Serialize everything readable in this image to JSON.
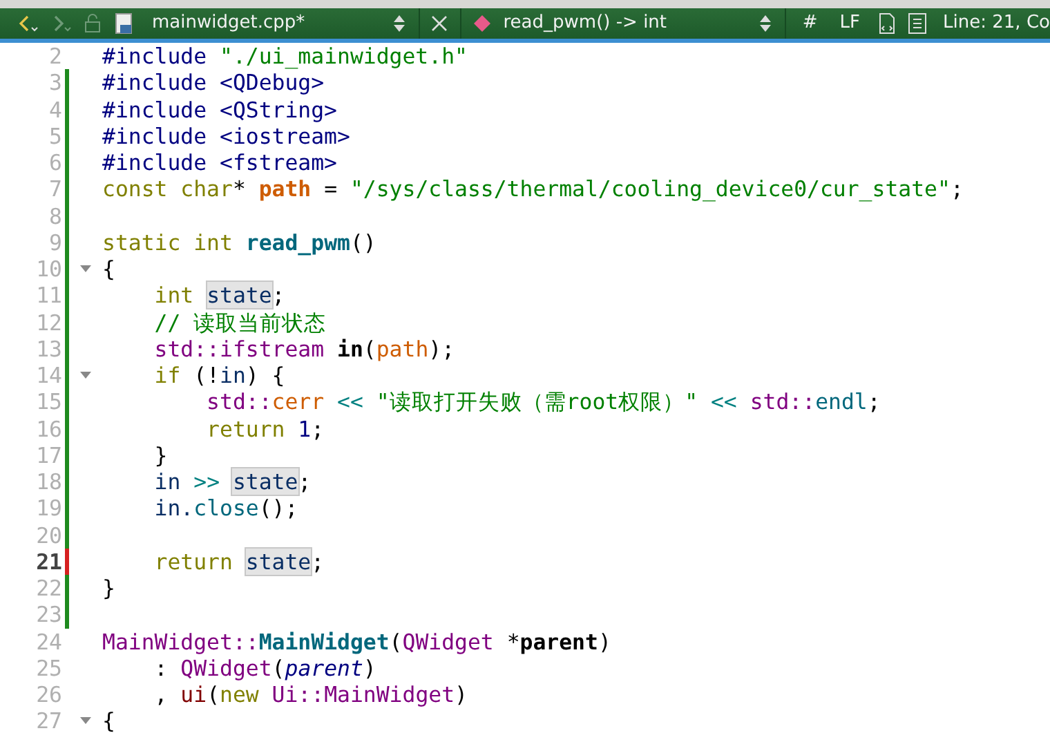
{
  "toolbar": {
    "back_enabled": true,
    "forward_enabled": false,
    "file_name": "mainwidget.cpp*",
    "symbol": "read_pwm() -> int",
    "hash": "#",
    "line_ending": "LF",
    "position": "Line: 21, Co"
  },
  "editor": {
    "lines": [
      {
        "number": "2",
        "fold": false,
        "current": false,
        "tokens": [
          {
            "kind": "preproc",
            "text": "#include "
          },
          {
            "kind": "string",
            "text": "\"./ui_mainwidget.h\""
          }
        ]
      },
      {
        "number": "3",
        "color": "#1e8a1e",
        "fold": false,
        "current": false,
        "tokens": [
          {
            "kind": "preproc",
            "text": "#include <QDebug>"
          }
        ]
      },
      {
        "number": "4",
        "color": "#1e8a1e",
        "fold": false,
        "current": false,
        "tokens": [
          {
            "kind": "preproc",
            "text": "#include <QString>"
          }
        ]
      },
      {
        "number": "5",
        "color": "#1e8a1e",
        "fold": false,
        "current": false,
        "tokens": [
          {
            "kind": "preproc",
            "text": "#include <iostream>"
          }
        ]
      },
      {
        "number": "6",
        "color": "#1e8a1e",
        "fold": false,
        "current": false,
        "tokens": [
          {
            "kind": "preproc",
            "text": "#include <fstream>"
          }
        ]
      },
      {
        "number": "7",
        "color": "#1e8a1e",
        "fold": false,
        "current": false,
        "tokens": [
          {
            "kind": "keyword",
            "text": "const char"
          },
          {
            "kind": "plain",
            "text": "* "
          },
          {
            "kind": "global",
            "text": "path"
          },
          {
            "kind": "plain",
            "text": " = "
          },
          {
            "kind": "string",
            "text": "\"/sys/class/thermal/cooling_device0/cur_state\""
          },
          {
            "kind": "plain",
            "text": ";"
          }
        ]
      },
      {
        "number": "8",
        "color": "#1e8a1e",
        "fold": false,
        "current": false
      },
      {
        "number": "9",
        "color": "#1e8a1e",
        "fold": false,
        "current": false,
        "tokens": [
          {
            "kind": "keyword",
            "text": "static int "
          },
          {
            "kind": "funcdef",
            "text": "read_pwm"
          },
          {
            "kind": "plain",
            "text": "()"
          }
        ]
      },
      {
        "number": "10",
        "color": "#1e8a1e",
        "fold": true,
        "current": false,
        "tokens": [
          {
            "kind": "plain",
            "text": "{"
          }
        ]
      },
      {
        "number": "11",
        "color": "#1e8a1e",
        "fold": false,
        "current": false,
        "tokens": [
          {
            "kind": "keyword",
            "text": "    int "
          },
          {
            "kind": "occurrence",
            "text": "state"
          },
          {
            "kind": "plain",
            "text": ";"
          }
        ]
      },
      {
        "number": "12",
        "color": "#1e8a1e",
        "fold": false,
        "current": false,
        "tokens": [
          {
            "kind": "comment",
            "text": "    // 读取当前状态"
          }
        ]
      },
      {
        "number": "13",
        "color": "#1e8a1e",
        "fold": false,
        "current": false,
        "tokens": [
          {
            "kind": "type",
            "text": "    std::ifstream "
          },
          {
            "kind": "bold",
            "text": "in"
          },
          {
            "kind": "plain",
            "text": "("
          },
          {
            "kind": "globalplain",
            "text": "path"
          },
          {
            "kind": "plain",
            "text": ");"
          }
        ]
      },
      {
        "number": "14",
        "color": "#1e8a1e",
        "fold": true,
        "current": false,
        "tokens": [
          {
            "kind": "keyword",
            "text": "    if"
          },
          {
            "kind": "plain",
            "text": " (!"
          },
          {
            "kind": "local",
            "text": "in"
          },
          {
            "kind": "plain",
            "text": ") {"
          }
        ]
      },
      {
        "number": "15",
        "color": "#1e8a1e",
        "fold": false,
        "current": false,
        "tokens": [
          {
            "kind": "type",
            "text": "        std::"
          },
          {
            "kind": "globalplain",
            "text": "cerr "
          },
          {
            "kind": "operator",
            "text": "<< "
          },
          {
            "kind": "string",
            "text": "\"读取打开失败（需root权限）\" "
          },
          {
            "kind": "operator",
            "text": "<< "
          },
          {
            "kind": "type",
            "text": "std::"
          },
          {
            "kind": "func",
            "text": "endl"
          },
          {
            "kind": "plain",
            "text": ";"
          }
        ]
      },
      {
        "number": "16",
        "color": "#1e8a1e",
        "fold": false,
        "current": false,
        "tokens": [
          {
            "kind": "keyword",
            "text": "        return "
          },
          {
            "kind": "number",
            "text": "1"
          },
          {
            "kind": "plain",
            "text": ";"
          }
        ]
      },
      {
        "number": "17",
        "color": "#1e8a1e",
        "fold": false,
        "current": false,
        "tokens": [
          {
            "kind": "plain",
            "text": "    }"
          }
        ]
      },
      {
        "number": "18",
        "color": "#1e8a1e",
        "fold": false,
        "current": false,
        "tokens": [
          {
            "kind": "local",
            "text": "    in "
          },
          {
            "kind": "operator",
            "text": ">> "
          },
          {
            "kind": "occurrence",
            "text": "state"
          },
          {
            "kind": "plain",
            "text": ";"
          }
        ]
      },
      {
        "number": "19",
        "color": "#1e8a1e",
        "fold": false,
        "current": false,
        "tokens": [
          {
            "kind": "local",
            "text": "    in."
          },
          {
            "kind": "func",
            "text": "close"
          },
          {
            "kind": "plain",
            "text": "();"
          }
        ]
      },
      {
        "number": "20",
        "color": "#1e8a1e",
        "fold": false,
        "current": false
      },
      {
        "number": "21",
        "color": "#d62020",
        "fold": false,
        "current": true,
        "tokens": [
          {
            "kind": "keyword",
            "text": "    return "
          },
          {
            "kind": "occurrence",
            "text": "state"
          },
          {
            "kind": "plain",
            "text": ";"
          }
        ]
      },
      {
        "number": "22",
        "color": "#1e8a1e",
        "fold": false,
        "current": false,
        "tokens": [
          {
            "kind": "plain",
            "text": "}"
          }
        ]
      },
      {
        "number": "23",
        "color": "#1e8a1e",
        "fold": false,
        "current": false
      },
      {
        "number": "24",
        "fold": false,
        "current": false,
        "tokens": [
          {
            "kind": "type",
            "text": "MainWidget::"
          },
          {
            "kind": "funcdef",
            "text": "MainWidget"
          },
          {
            "kind": "plain",
            "text": "("
          },
          {
            "kind": "type",
            "text": "QWidget "
          },
          {
            "kind": "plain",
            "text": "*"
          },
          {
            "kind": "bold",
            "text": "parent"
          },
          {
            "kind": "plain",
            "text": ")"
          }
        ]
      },
      {
        "number": "25",
        "fold": false,
        "current": false,
        "tokens": [
          {
            "kind": "plain",
            "text": "    : "
          },
          {
            "kind": "type",
            "text": "QWidget"
          },
          {
            "kind": "plain",
            "text": "("
          },
          {
            "kind": "param",
            "text": "parent"
          },
          {
            "kind": "plain",
            "text": ")"
          }
        ]
      },
      {
        "number": "26",
        "fold": false,
        "current": false,
        "tokens": [
          {
            "kind": "plain",
            "text": "    , "
          },
          {
            "kind": "member",
            "text": "ui"
          },
          {
            "kind": "plain",
            "text": "("
          },
          {
            "kind": "keyword",
            "text": "new "
          },
          {
            "kind": "type",
            "text": "Ui::MainWidget"
          },
          {
            "kind": "plain",
            "text": ")"
          }
        ]
      },
      {
        "number": "27",
        "fold": true,
        "current": false,
        "tokens": [
          {
            "kind": "plain",
            "text": "{"
          }
        ]
      }
    ]
  }
}
